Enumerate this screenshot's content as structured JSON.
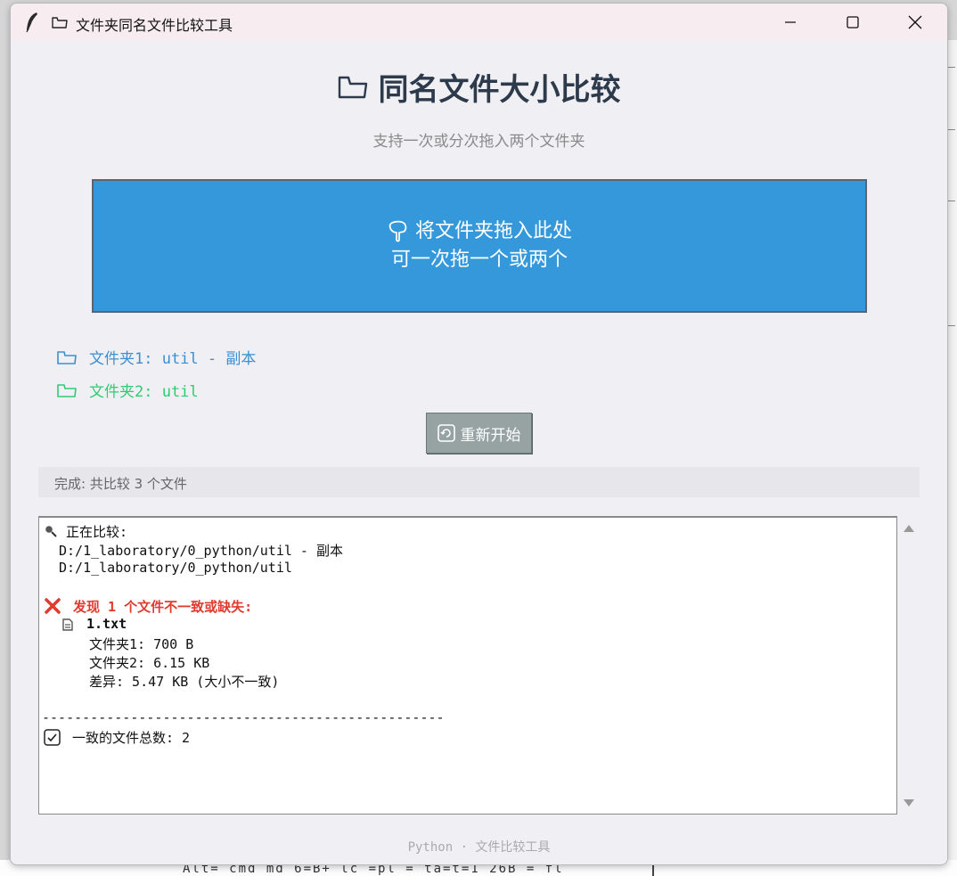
{
  "window": {
    "title": "文件夹同名文件比较工具",
    "icons": [
      "feather-icon",
      "folder-icon"
    ],
    "controls": [
      "minimize-icon",
      "maximize-icon",
      "close-icon"
    ]
  },
  "header": {
    "title": "同名文件大小比较",
    "subtitle": "支持一次或分次拖入两个文件夹"
  },
  "dropzone": {
    "line1": "将文件夹拖入此处",
    "line2": "可一次拖一个或两个",
    "color": "#3498db"
  },
  "folders": {
    "folder1": "文件夹1: util - 副本",
    "folder2": "文件夹2: util",
    "folder1_color": "#3a8fd1",
    "folder2_color": "#2ecc71"
  },
  "reset_button": {
    "label": "重新开始"
  },
  "status": {
    "text": "完成: 共比较 3 个文件"
  },
  "log": {
    "comparing_label": "正在比较:",
    "path1": "D:/1_laboratory/0_python/util - 副本",
    "path2": "D:/1_laboratory/0_python/util",
    "mismatch_header": "发现 1 个文件不一致或缺失:",
    "file_name": "1.txt",
    "size1": "文件夹1: 700 B",
    "size2": "文件夹2: 6.15 KB",
    "diff": "差异: 5.47 KB (大小不一致)",
    "separator": "--------------------------------------------------",
    "consistent": "一致的文件总数: 2"
  },
  "footer": {
    "text": "Python · 文件比较工具"
  },
  "background": {
    "text": "Alt= cmd md 6=B+ lc =pl = ta=t=1 26B  = fl"
  }
}
